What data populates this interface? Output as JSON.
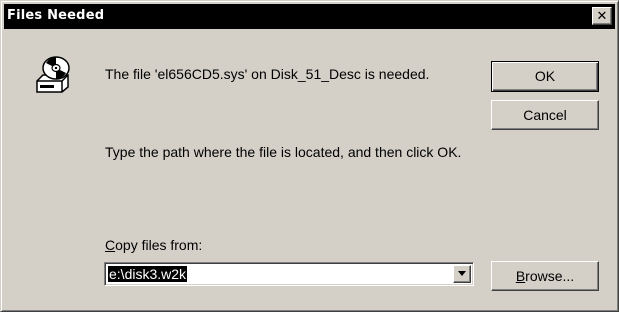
{
  "dialog": {
    "title": "Files Needed",
    "close_label": "✕",
    "icon": "disk-drive-icon",
    "message": "The file 'el656CD5.sys' on Disk_51_Desc is needed.",
    "instruction": "Type the path where the file is located, and then click OK.",
    "copy_from": {
      "label_accel": "C",
      "label_rest": "opy files from:",
      "value": "e:\\disk3.w2k"
    },
    "buttons": {
      "ok": "OK",
      "cancel": "Cancel",
      "browse_accel": "B",
      "browse_rest": "rowse..."
    }
  },
  "colors": {
    "face": "#d4d0c8",
    "titlebar": "#000000",
    "selection": "#000000"
  }
}
